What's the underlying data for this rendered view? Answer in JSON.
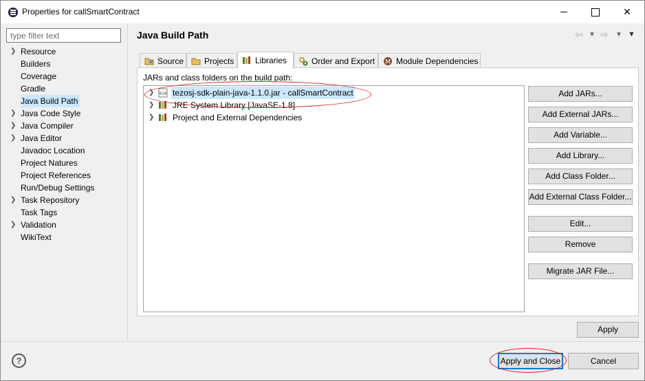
{
  "window": {
    "title": "Properties for callSmartContract"
  },
  "filter": {
    "placeholder": "type filter text"
  },
  "nav": {
    "items": [
      {
        "label": "Resource",
        "expandable": true
      },
      {
        "label": "Builders",
        "expandable": false
      },
      {
        "label": "Coverage",
        "expandable": false
      },
      {
        "label": "Gradle",
        "expandable": false
      },
      {
        "label": "Java Build Path",
        "expandable": false,
        "selected": true
      },
      {
        "label": "Java Code Style",
        "expandable": true
      },
      {
        "label": "Java Compiler",
        "expandable": true
      },
      {
        "label": "Java Editor",
        "expandable": true
      },
      {
        "label": "Javadoc Location",
        "expandable": false
      },
      {
        "label": "Project Natures",
        "expandable": false
      },
      {
        "label": "Project References",
        "expandable": false
      },
      {
        "label": "Run/Debug Settings",
        "expandable": false
      },
      {
        "label": "Task Repository",
        "expandable": true
      },
      {
        "label": "Task Tags",
        "expandable": false
      },
      {
        "label": "Validation",
        "expandable": true
      },
      {
        "label": "WikiText",
        "expandable": false
      }
    ]
  },
  "page": {
    "title": "Java Build Path"
  },
  "tabs": [
    {
      "label": "Source",
      "icon": "source-folder-icon"
    },
    {
      "label": "Projects",
      "icon": "projects-folder-icon"
    },
    {
      "label": "Libraries",
      "icon": "libraries-icon",
      "active": true
    },
    {
      "label": "Order and Export",
      "icon": "order-export-icon"
    },
    {
      "label": "Module Dependencies",
      "icon": "module-dependencies-icon"
    }
  ],
  "libraries": {
    "label": "JARs and class folders on the build path:",
    "entries": [
      {
        "label": "tezosj-sdk-plain-java-1.1.0.jar - callSmartContract",
        "icon": "jar-icon",
        "selected": true
      },
      {
        "label": "JRE System Library [JavaSE-1.8]",
        "icon": "library-icon"
      },
      {
        "label": "Project and External Dependencies",
        "icon": "library-icon"
      }
    ],
    "buttons": [
      "Add JARs...",
      "Add External JARs...",
      "Add Variable...",
      "Add Library...",
      "Add Class Folder...",
      "Add External Class Folder...",
      "Edit...",
      "Remove",
      "Migrate JAR File..."
    ]
  },
  "apply": "Apply",
  "footer": {
    "help": "?",
    "apply_close": "Apply and Close",
    "cancel": "Cancel"
  },
  "colors": {
    "selection": "#cce8ff",
    "annotation": "#d62020",
    "focus": "#0078d7"
  }
}
